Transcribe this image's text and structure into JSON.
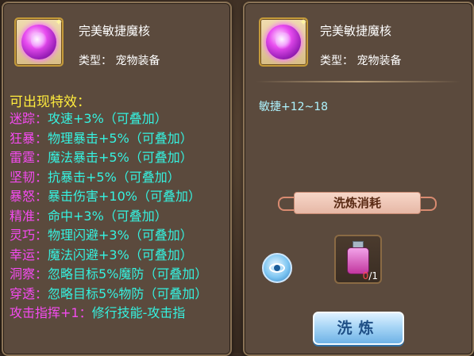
{
  "left_panel": {
    "item_name": "完美敏捷魔核",
    "item_type": "类型：   宠物装备",
    "effects_title": "可出现特效：",
    "effects": [
      {
        "name": "迷踪：",
        "desc": "攻速+3%（可叠加）"
      },
      {
        "name": "狂暴：",
        "desc": "物理暴击+5%（可叠加）"
      },
      {
        "name": "雷霆：",
        "desc": "魔法暴击+5%（可叠加）"
      },
      {
        "name": "坚韧：",
        "desc": "抗暴击+5%（可叠加）"
      },
      {
        "name": "暴怒：",
        "desc": "暴击伤害+10%（可叠加）"
      },
      {
        "name": "精准：",
        "desc": "命中+3%（可叠加）"
      },
      {
        "name": "灵巧：",
        "desc": "物理闪避+3%（可叠加）"
      },
      {
        "name": "幸运：",
        "desc": "魔法闪避+3%（可叠加）"
      },
      {
        "name": "洞察：",
        "desc": "忽略目标5%魔防（可叠加）"
      },
      {
        "name": "穿透：",
        "desc": "忽略目标5%物防（可叠加）"
      },
      {
        "name": "攻击指挥+1：",
        "desc": "修行技能-攻击指"
      }
    ]
  },
  "right_panel": {
    "item_name": "完美敏捷魔核",
    "item_type": "类型：   宠物装备",
    "stat_line": "敏捷+12~18",
    "cost_title": "洗炼消耗",
    "material_count_have": "0",
    "material_count_sep": "/1",
    "wash_button": "洗炼"
  },
  "icons": {
    "item_icon": "purple-magic-core-orb",
    "preview_icon": "eye-icon",
    "material_icon": "pink-potion-bottle"
  },
  "colors": {
    "effect_name": "#f44bf0",
    "effect_desc": "#35f2e0",
    "effects_title": "#ffec3d",
    "stat_text": "#aef4ff",
    "panel_bg": "#5b4a3d"
  }
}
